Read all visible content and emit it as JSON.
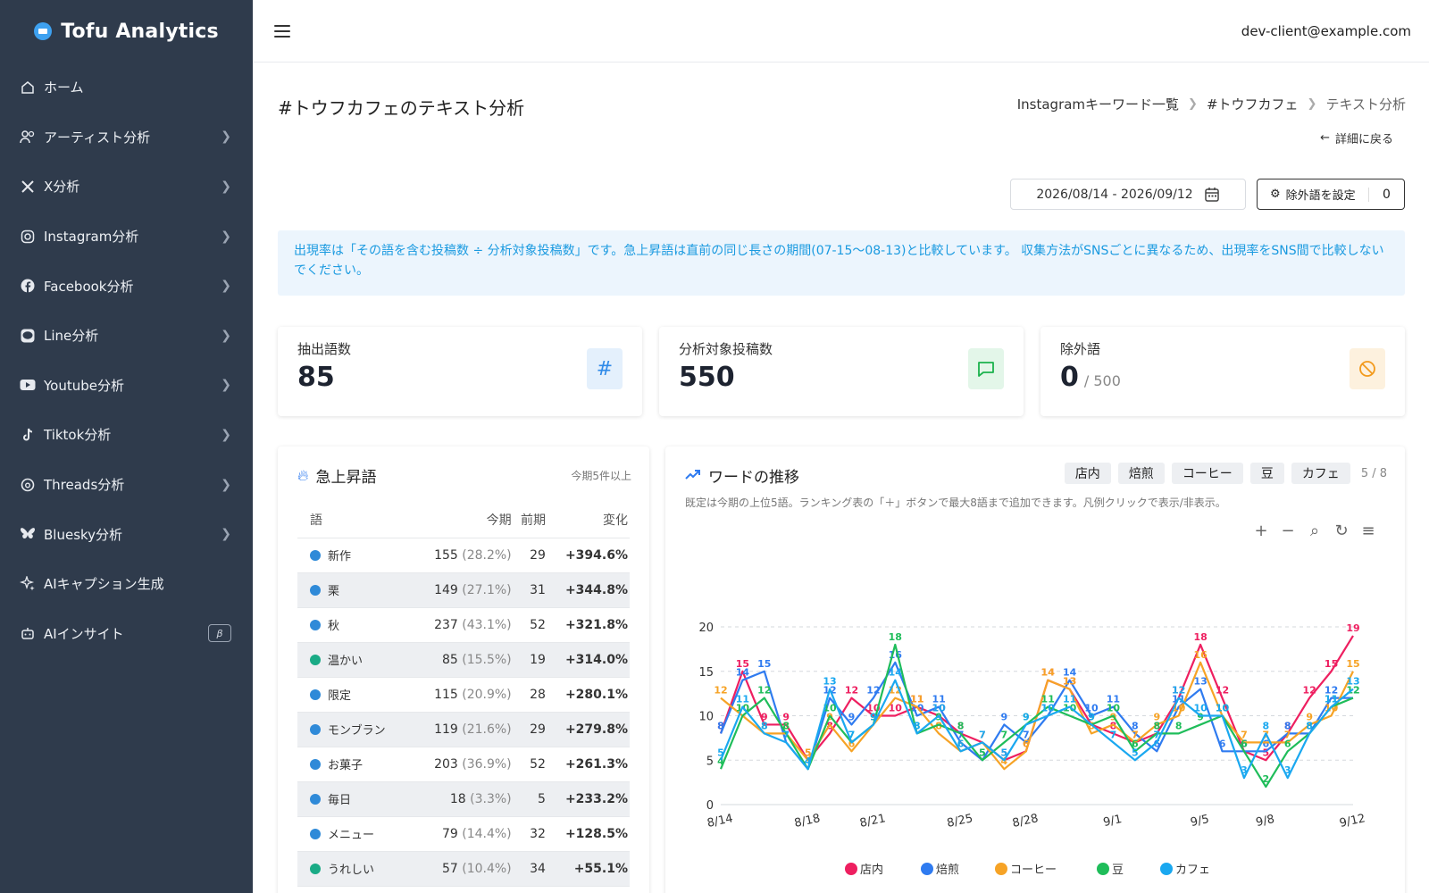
{
  "app": {
    "title": "Tofu Analytics"
  },
  "user": {
    "email": "dev-client@example.com"
  },
  "sidebar": {
    "items": [
      {
        "label": "ホーム",
        "icon": "home-icon",
        "chevron": false
      },
      {
        "label": "アーティスト分析",
        "icon": "users-icon",
        "chevron": true
      },
      {
        "label": "X分析",
        "icon": "x-icon",
        "chevron": true
      },
      {
        "label": "Instagram分析",
        "icon": "instagram-icon",
        "chevron": true
      },
      {
        "label": "Facebook分析",
        "icon": "facebook-icon",
        "chevron": true
      },
      {
        "label": "Line分析",
        "icon": "line-icon",
        "chevron": true
      },
      {
        "label": "Youtube分析",
        "icon": "youtube-icon",
        "chevron": true
      },
      {
        "label": "Tiktok分析",
        "icon": "tiktok-icon",
        "chevron": true
      },
      {
        "label": "Threads分析",
        "icon": "threads-icon",
        "chevron": true
      },
      {
        "label": "Bluesky分析",
        "icon": "bluesky-icon",
        "chevron": true
      },
      {
        "label": "AIキャプション生成",
        "icon": "sparkle-icon",
        "chevron": false
      },
      {
        "label": "AIインサイト",
        "icon": "robot-icon",
        "chevron": false,
        "badge": "β"
      }
    ]
  },
  "page": {
    "title": "#トウフカフェのテキスト分析",
    "breadcrumb": [
      "Instagramキーワード一覧",
      "#トウフカフェ",
      "テキスト分析"
    ],
    "back_label": "詳細に戻る",
    "date_range": "2026/08/14 - 2026/09/12",
    "exclude_button": "除外語を設定",
    "exclude_count": "0",
    "notice": "出現率は「その語を含む投稿数 ÷ 分析対象投稿数」です。急上昇語は直前の同じ長さの期間(07-15〜08-13)と比較しています。 収集方法がSNSごとに異なるため、出現率をSNS間で比較しないでください。"
  },
  "stats": [
    {
      "label": "抽出語数",
      "value": "85",
      "sub": "",
      "icon": "hash-icon",
      "color": "#2f8ae8",
      "bg": "#e4f0fc"
    },
    {
      "label": "分析対象投稿数",
      "value": "550",
      "sub": "",
      "icon": "chat-icon",
      "color": "#1bb24d",
      "bg": "#e3f6e9"
    },
    {
      "label": "除外語",
      "value": "0",
      "sub": "/ 500",
      "icon": "ban-icon",
      "color": "#f29a1c",
      "bg": "#fdf1de"
    }
  ],
  "ranking": {
    "title": "急上昇語",
    "note": "今期5件以上",
    "headers": [
      "語",
      "今期",
      "前期",
      "変化"
    ],
    "rows": [
      {
        "word": "新作",
        "current": "155",
        "pct": "(28.2%)",
        "previous": "29",
        "change": "+394.6%",
        "dot": "#2f8ad8"
      },
      {
        "word": "栗",
        "current": "149",
        "pct": "(27.1%)",
        "previous": "31",
        "change": "+344.8%",
        "dot": "#2f8ad8"
      },
      {
        "word": "秋",
        "current": "237",
        "pct": "(43.1%)",
        "previous": "52",
        "change": "+321.8%",
        "dot": "#2f8ad8"
      },
      {
        "word": "温かい",
        "current": "85",
        "pct": "(15.5%)",
        "previous": "19",
        "change": "+314.0%",
        "dot": "#1aab86"
      },
      {
        "word": "限定",
        "current": "115",
        "pct": "(20.9%)",
        "previous": "28",
        "change": "+280.1%",
        "dot": "#2f8ad8"
      },
      {
        "word": "モンブラン",
        "current": "119",
        "pct": "(21.6%)",
        "previous": "29",
        "change": "+279.8%",
        "dot": "#2f8ad8"
      },
      {
        "word": "お菓子",
        "current": "203",
        "pct": "(36.9%)",
        "previous": "52",
        "change": "+261.3%",
        "dot": "#2f8ad8"
      },
      {
        "word": "毎日",
        "current": "18",
        "pct": "(3.3%)",
        "previous": "5",
        "change": "+233.2%",
        "dot": "#2f8ad8"
      },
      {
        "word": "メニュー",
        "current": "79",
        "pct": "(14.4%)",
        "previous": "32",
        "change": "+128.5%",
        "dot": "#2f8ad8"
      },
      {
        "word": "うれしい",
        "current": "57",
        "pct": "(10.4%)",
        "previous": "34",
        "change": "+55.1%",
        "dot": "#1aab86"
      }
    ]
  },
  "trend": {
    "title": "ワードの推移",
    "description": "既定は今期の上位5語。ランキング表の「＋」ボタンで最大8語まで追加できます。凡例クリックで表示/非表示。",
    "chips": [
      "店内",
      "焙煎",
      "コーヒー",
      "豆",
      "カフェ"
    ],
    "count_label": "5 / 8"
  },
  "chart_data": {
    "type": "line",
    "x": [
      "8/14",
      "8/15",
      "8/16",
      "8/17",
      "8/18",
      "8/19",
      "8/20",
      "8/21",
      "8/22",
      "8/23",
      "8/24",
      "8/25",
      "8/26",
      "8/27",
      "8/28",
      "8/29",
      "8/30",
      "8/31",
      "9/1",
      "9/2",
      "9/3",
      "9/4",
      "9/5",
      "9/6",
      "9/7",
      "9/8",
      "9/9",
      "9/10",
      "9/11",
      "9/12"
    ],
    "x_tick_labels": [
      "8/14",
      "8/18",
      "8/21",
      "8/25",
      "8/28",
      "9/1",
      "9/5",
      "9/8",
      "9/12"
    ],
    "y_ticks": [
      0,
      5,
      10,
      15,
      20
    ],
    "ylim": [
      0,
      20
    ],
    "grid": true,
    "legend_position": "bottom",
    "series": [
      {
        "name": "店内",
        "color": "#ee1f60",
        "values": [
          8,
          15,
          9,
          9,
          5,
          8,
          12,
          10,
          10,
          11,
          10,
          8,
          7,
          5,
          6,
          14,
          13,
          9,
          8,
          7,
          8,
          12,
          18,
          12,
          6,
          5,
          8,
          12,
          15,
          19
        ]
      },
      {
        "name": "焙煎",
        "color": "#2f7bf0",
        "values": [
          8,
          14,
          15,
          7,
          4,
          12,
          9,
          12,
          16,
          10,
          11,
          7,
          5,
          9,
          7,
          10,
          14,
          10,
          11,
          8,
          6,
          11,
          13,
          6,
          6,
          6,
          8,
          8,
          12,
          12
        ]
      },
      {
        "name": "コーヒー",
        "color": "#f6a326",
        "values": [
          12,
          10,
          8,
          8,
          5,
          9,
          6,
          9,
          12,
          11,
          8,
          6,
          7,
          4,
          6,
          14,
          13,
          8,
          9,
          7,
          9,
          10,
          16,
          10,
          7,
          7,
          7,
          9,
          10,
          15
        ]
      },
      {
        "name": "豆",
        "color": "#1fbd5a",
        "values": [
          4,
          10,
          12,
          8,
          4,
          10,
          7,
          9,
          18,
          8,
          9,
          8,
          5,
          7,
          9,
          11,
          10,
          9,
          10,
          6,
          8,
          8,
          9,
          10,
          6,
          2,
          6,
          8,
          11,
          12
        ]
      },
      {
        "name": "カフェ",
        "color": "#1aa8f0",
        "values": [
          5,
          11,
          8,
          7,
          4,
          13,
          7,
          9,
          14,
          8,
          10,
          6,
          7,
          5,
          9,
          10,
          11,
          9,
          7,
          5,
          7,
          12,
          10,
          10,
          3,
          8,
          3,
          8,
          11,
          13
        ]
      }
    ]
  }
}
